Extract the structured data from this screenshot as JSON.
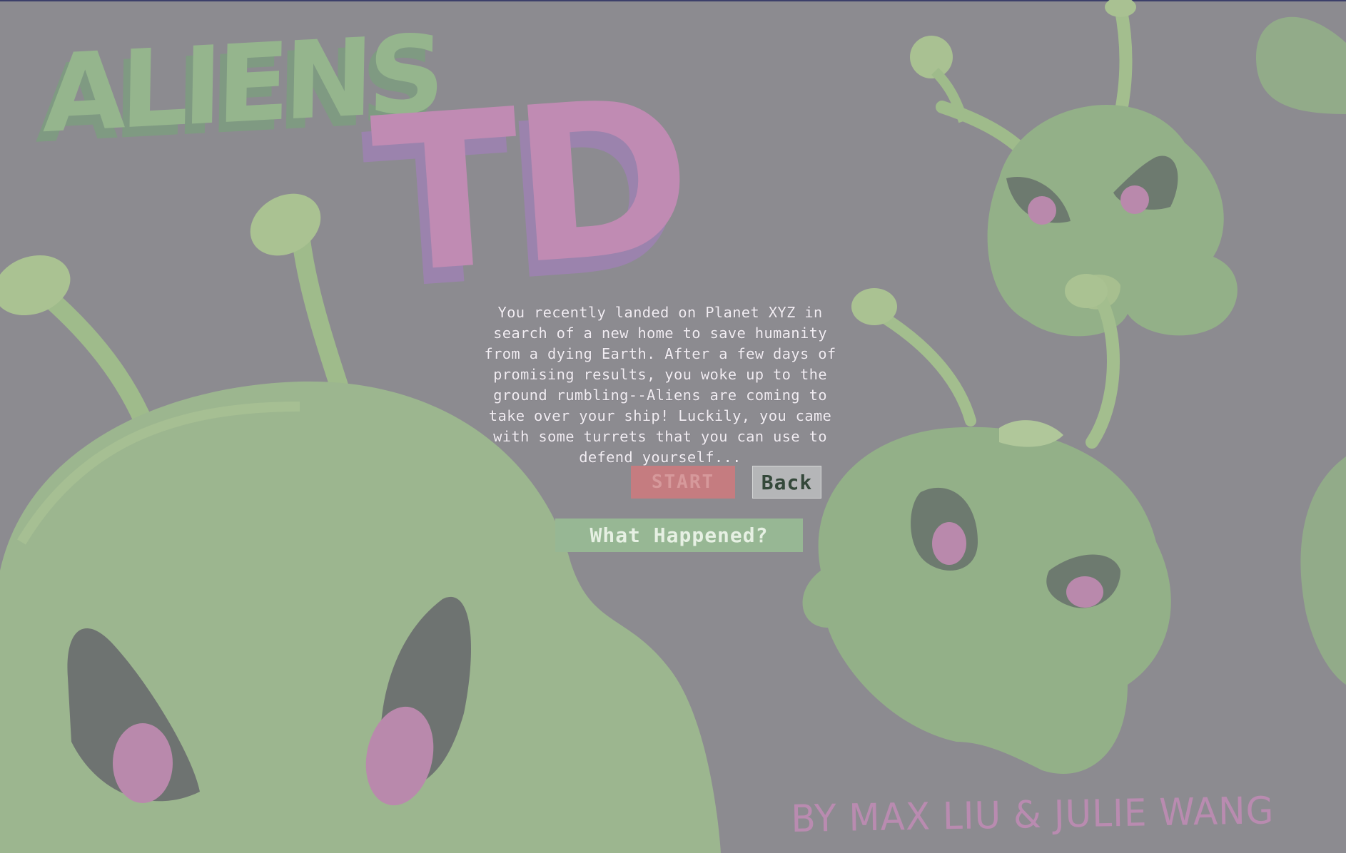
{
  "game": {
    "title_line1": "ALIENS",
    "title_line2": "TD",
    "credits": "BY MAX LIU & JULIE WANG",
    "story": "You recently landed on Planet XYZ in search of a new home to save humanity from a dying Earth. After a few days of promising results, you woke up to the ground rumbling--Aliens are coming to take over your ship! Luckily, you came with some turrets that you can use to defend yourself...",
    "buttons": {
      "start": "START",
      "back": "Back",
      "what_happened": "What Happened?"
    }
  },
  "colors": {
    "background": "#8c8b90",
    "alien_green": "#9cb68f",
    "alien_eye_pink": "#b989ac",
    "title_green": "#95b58d",
    "title_pink": "#c08bb3",
    "start_button": "#c57c80",
    "back_button": "#b5b6b8",
    "what_happened_button": "#97b794"
  }
}
